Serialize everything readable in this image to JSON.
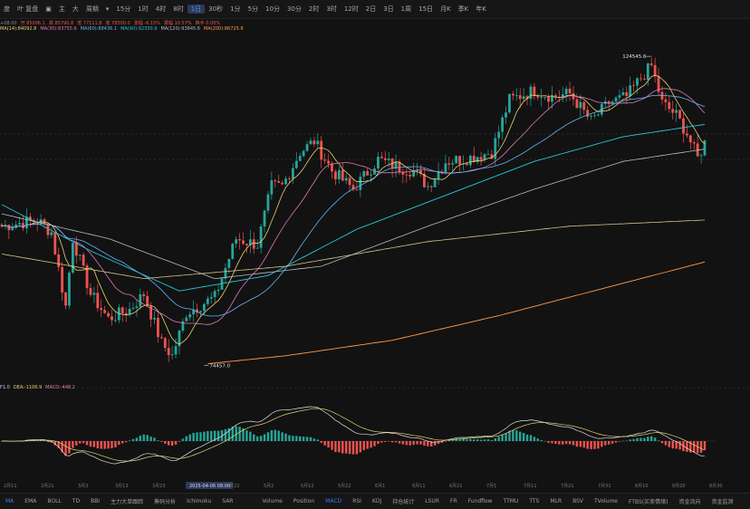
{
  "toolbar": {
    "items": [
      "度",
      "叶 复盘",
      "▣",
      "主",
      "大",
      "周期",
      "▾",
      "15分",
      "1时",
      "4时",
      "8时",
      "1日",
      "30秒",
      "1分",
      "5分",
      "10分",
      "30分",
      "2时",
      "3时",
      "12时",
      "2日",
      "3日",
      "1周",
      "15日",
      "月K",
      "季K",
      "年K"
    ],
    "active_index": 11
  },
  "indicator_lines": {
    "line1": [
      "+08:00",
      "开 85006.1",
      "高 85790.8",
      "低 77111.8",
      "收 78300.0",
      "涨幅 -6.15%",
      "振幅 10.57%",
      "换手 0.00%"
    ],
    "line2": [
      "MA(14):84092.8",
      "MA(30):83755.6",
      "MA(60):88436.1",
      "MA(90):92330.9",
      "MA(120):93845.6",
      "MA(200):86725.9"
    ],
    "line3": [
      "F1.0",
      "DEA:-1106.9",
      "MACD:-448.2"
    ]
  },
  "chart_data": {
    "type": "candlestick",
    "x_tick_labels": [
      "2月11",
      "2月21",
      "3月3",
      "3月13",
      "3月23",
      "2025-04-06 08:00",
      "4月22",
      "5月2",
      "5月12",
      "5月22",
      "6月1",
      "6月11",
      "6月21",
      "7月1",
      "7月11",
      "7月21",
      "7月31",
      "8月10",
      "8月20",
      "8月30"
    ],
    "annotations": {
      "high_label": "124545.6",
      "low_label": "74457.0"
    },
    "price_ylim": [
      72000,
      130000
    ],
    "series_colors": {
      "up": "#26a69a",
      "down": "#ef5350",
      "ma14": "#e6d36f",
      "ma30": "#e078b6",
      "ma60": "#64b5f6",
      "ma90": "#26c6da",
      "ma120": "#b0bec5",
      "ma200": "#ff9a4d"
    },
    "close_anchors": [
      [
        0,
        97000
      ],
      [
        10,
        98000
      ],
      [
        14,
        96000
      ],
      [
        18,
        84000
      ],
      [
        20,
        95000
      ],
      [
        25,
        86000
      ],
      [
        30,
        82000
      ],
      [
        36,
        83500
      ],
      [
        40,
        86000
      ],
      [
        45,
        78000
      ],
      [
        48,
        76000
      ],
      [
        52,
        83000
      ],
      [
        60,
        85500
      ],
      [
        66,
        95000
      ],
      [
        72,
        94000
      ],
      [
        76,
        103500
      ],
      [
        79,
        103500
      ],
      [
        84,
        109000
      ],
      [
        88,
        110800
      ],
      [
        93,
        106000
      ],
      [
        99,
        103000
      ],
      [
        106,
        107800
      ],
      [
        112,
        106500
      ],
      [
        116,
        106000
      ],
      [
        120,
        103500
      ],
      [
        125,
        107500
      ],
      [
        131,
        108000
      ],
      [
        138,
        109000
      ],
      [
        143,
        117500
      ],
      [
        150,
        119000
      ],
      [
        155,
        118000
      ],
      [
        160,
        118500
      ],
      [
        166,
        114000
      ],
      [
        171,
        117000
      ],
      [
        176,
        118000
      ],
      [
        180,
        121000
      ],
      [
        183,
        123000
      ],
      [
        186,
        117000
      ],
      [
        190,
        115000
      ],
      [
        193,
        112000
      ],
      [
        196,
        108000
      ],
      [
        198,
        110500
      ]
    ],
    "ma": {
      "ma90": [
        [
          0,
          100500
        ],
        [
          25,
          93000
        ],
        [
          50,
          86500
        ],
        [
          75,
          89000
        ],
        [
          100,
          96500
        ],
        [
          125,
          102000
        ],
        [
          150,
          107500
        ],
        [
          175,
          111500
        ],
        [
          198,
          113500
        ]
      ],
      "ma120": [
        [
          0,
          99000
        ],
        [
          30,
          95000
        ],
        [
          60,
          88500
        ],
        [
          90,
          90500
        ],
        [
          120,
          97000
        ],
        [
          150,
          103000
        ],
        [
          175,
          107500
        ],
        [
          198,
          109500
        ]
      ],
      "ma200": [
        [
          0,
          92500
        ],
        [
          40,
          88500
        ],
        [
          80,
          90500
        ],
        [
          120,
          94500
        ],
        [
          160,
          97000
        ],
        [
          198,
          98000
        ]
      ],
      "ma_long": [
        [
          58,
          74700
        ],
        [
          80,
          76000
        ],
        [
          110,
          78500
        ],
        [
          140,
          82500
        ],
        [
          170,
          87000
        ],
        [
          198,
          91200
        ]
      ]
    },
    "macd": {
      "dif_final": -1106.9,
      "macd_final": -448.2
    }
  },
  "bottom_tabs": {
    "left": [
      "MA",
      "EMA",
      "BOLL",
      "TD",
      "BBI",
      "主力大单跟踪",
      "筹码分析",
      "Ichimoku",
      "SAR"
    ],
    "right": [
      "Volume",
      "Position",
      "MACD",
      "RSI",
      "KDJ",
      "持仓统计",
      "LSUR",
      "FR",
      "Fundflow",
      "TTMU",
      "TTS",
      "MLR",
      "BSV",
      "TVolume",
      "FTBS(买卖情绪)",
      "资金流向",
      "资金监测"
    ],
    "active_left": "MA",
    "active_right": "MACD"
  }
}
